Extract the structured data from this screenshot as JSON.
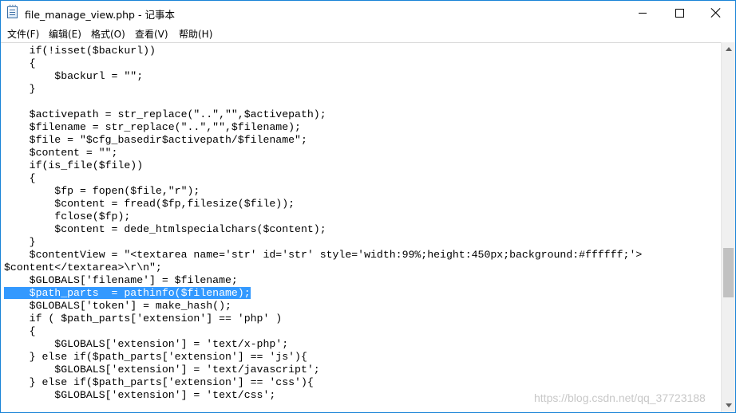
{
  "window": {
    "title": "file_manage_view.php - 记事本"
  },
  "menu": [
    {
      "label": "文件(F)"
    },
    {
      "label": "编辑(E)"
    },
    {
      "label": "格式(O)"
    },
    {
      "label": "查看(V)"
    },
    {
      "label": "帮助(H)"
    }
  ],
  "editor": {
    "lines": [
      "    if(!isset($backurl))",
      "    {",
      "        $backurl = \"\";",
      "    }",
      "",
      "    $activepath = str_replace(\"..\",\"\",$activepath);",
      "    $filename = str_replace(\"..\",\"\",$filename);",
      "    $file = \"$cfg_basedir$activepath/$filename\";",
      "    $content = \"\";",
      "    if(is_file($file))",
      "    {",
      "        $fp = fopen($file,\"r\");",
      "        $content = fread($fp,filesize($file));",
      "        fclose($fp);",
      "        $content = dede_htmlspecialchars($content);",
      "    }",
      "    $contentView = \"<textarea name='str' id='str' style='width:99%;height:450px;background:#ffffff;'>",
      "$content</textarea>\\r\\n\";",
      "    $GLOBALS['filename'] = $filename;",
      "    $path_parts  = pathinfo($filename);",
      "    $GLOBALS['token'] = make_hash();",
      "    if ( $path_parts['extension'] == 'php' )",
      "    {",
      "        $GLOBALS['extension'] = 'text/x-php';",
      "    } else if($path_parts['extension'] == 'js'){",
      "        $GLOBALS['extension'] = 'text/javascript';",
      "    } else if($path_parts['extension'] == 'css'){",
      "        $GLOBALS['extension'] = 'text/css';"
    ],
    "selected_line_index": 19
  },
  "watermark": "https://blog.csdn.net/qq_37723188",
  "colors": {
    "window_border": "#1883d7",
    "selection": "#3399ff"
  }
}
